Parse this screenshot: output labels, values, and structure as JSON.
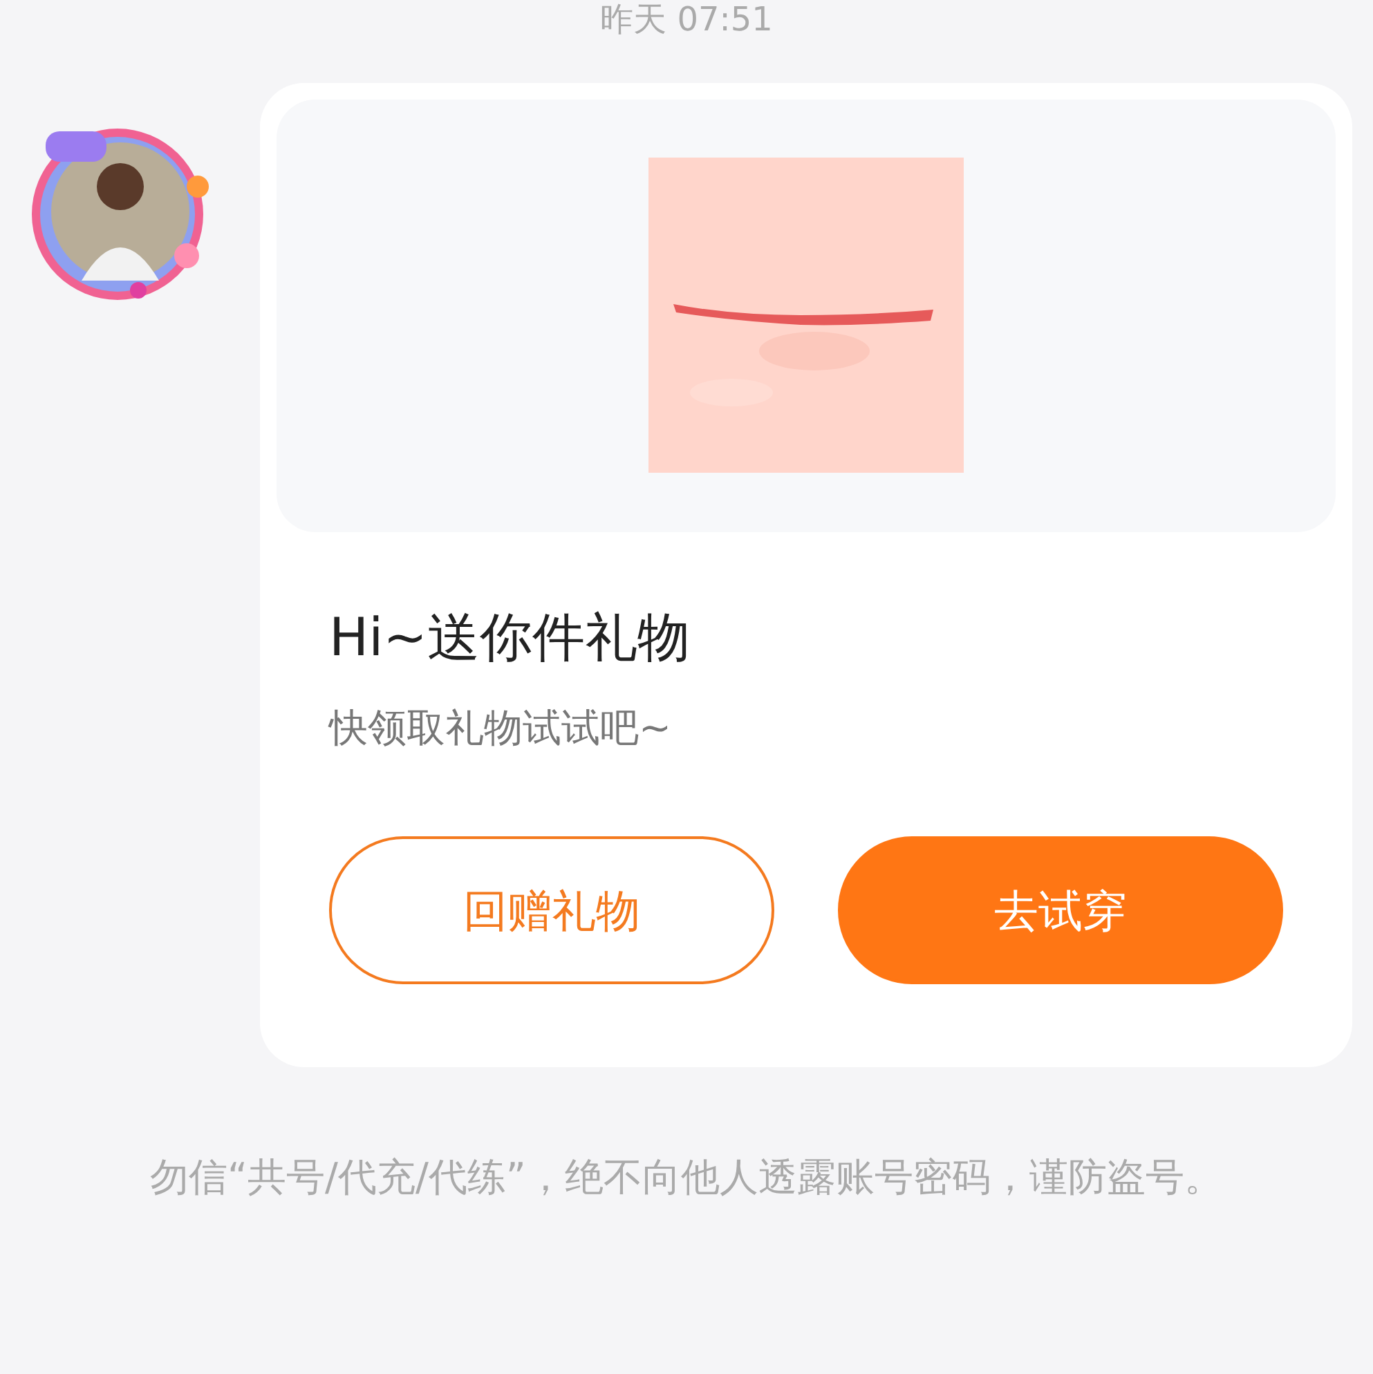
{
  "timestamp": "昨天 07:51",
  "message": {
    "title": "Hi~送你件礼物",
    "subtitle": "快领取礼物试试吧~",
    "buttons": [
      {
        "label": "回赠礼物",
        "kind": "outline"
      },
      {
        "label": "去试穿",
        "kind": "filled"
      }
    ]
  },
  "notice": "勿信“共号/代充/代练”，绝不向他人透露账号密码，谨防盗号。"
}
